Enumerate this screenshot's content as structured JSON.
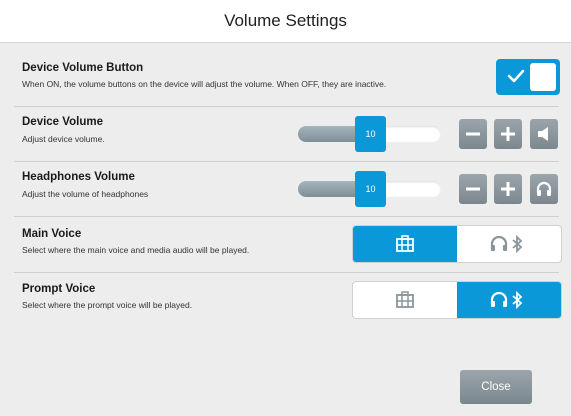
{
  "header": {
    "title": "Volume Settings"
  },
  "device_volume_button": {
    "label": "Device Volume Button",
    "description": "When ON, the volume buttons on the device will adjust the volume. When OFF, they are inactive.",
    "state": "on"
  },
  "device_volume": {
    "label": "Device Volume",
    "description": "Adjust device volume.",
    "value": "10",
    "icon": "speaker-icon"
  },
  "headphones_volume": {
    "label": "Headphones Volume",
    "description": "Adjust the volume of headphones",
    "value": "10",
    "icon": "headphones-icon"
  },
  "main_voice": {
    "label": "Main Voice",
    "description": "Select where the main voice and media audio will be played.",
    "options": [
      "device-icon",
      "headphones-bluetooth-icon"
    ],
    "selected": "device"
  },
  "prompt_voice": {
    "label": "Prompt Voice",
    "description": "Select where the prompt voice will be played.",
    "options": [
      "device-icon",
      "headphones-bluetooth-icon"
    ],
    "selected": "headphones-bluetooth"
  },
  "footer": {
    "close_label": "Close"
  },
  "colors": {
    "accent": "#0a98d8",
    "button_gray": "#8a959b",
    "background": "#ededee"
  }
}
